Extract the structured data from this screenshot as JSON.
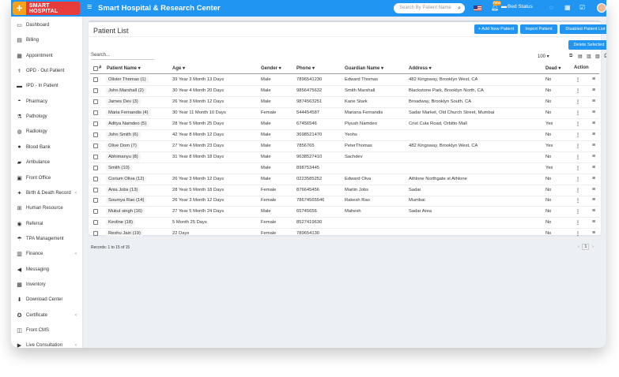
{
  "header": {
    "logo_text": "SMART HOSPITAL",
    "app_title": "Smart Hospital & Research Center",
    "search_placeholder": "Search By Patient Name",
    "bed_status": "Bed Status",
    "bell_badge": "new"
  },
  "sidebar": {
    "items": [
      {
        "label": "Dashboard",
        "icon": "monitor-icon",
        "chev": false
      },
      {
        "label": "Billing",
        "icon": "file-icon",
        "chev": false
      },
      {
        "label": "Appointment",
        "icon": "calendar-icon",
        "chev": false
      },
      {
        "label": "OPD - Out Patient",
        "icon": "stethoscope-icon",
        "chev": false
      },
      {
        "label": "IPD - In Patient",
        "icon": "procedures-icon",
        "chev": false
      },
      {
        "label": "Pharmacy",
        "icon": "mortar-icon",
        "chev": false
      },
      {
        "label": "Pathology",
        "icon": "flask-icon",
        "chev": false
      },
      {
        "label": "Radiology",
        "icon": "microscope-icon",
        "chev": false
      },
      {
        "label": "Blood Bank",
        "icon": "tint-icon",
        "chev": false
      },
      {
        "label": "Ambulance",
        "icon": "ambulance-icon",
        "chev": false
      },
      {
        "label": "Front Office",
        "icon": "dumpster-icon",
        "chev": false
      },
      {
        "label": "Birth & Death Record",
        "icon": "birthday-icon",
        "chev": true
      },
      {
        "label": "Human Resource",
        "icon": "sitemap-icon",
        "chev": false
      },
      {
        "label": "Referral",
        "icon": "users-icon",
        "chev": false
      },
      {
        "label": "TPA Management",
        "icon": "umbrella-icon",
        "chev": false
      },
      {
        "label": "Finance",
        "icon": "money-icon",
        "chev": true
      },
      {
        "label": "Messaging",
        "icon": "bullhorn-icon",
        "chev": false
      },
      {
        "label": "Inventory",
        "icon": "box-icon",
        "chev": false
      },
      {
        "label": "Download Center",
        "icon": "download-icon",
        "chev": false
      },
      {
        "label": "Certificate",
        "icon": "certificate-icon",
        "chev": true
      },
      {
        "label": "Front CMS",
        "icon": "cms-icon",
        "chev": false
      },
      {
        "label": "Live Consultation",
        "icon": "video-icon",
        "chev": true
      }
    ]
  },
  "panel": {
    "title": "Patient List",
    "add_btn": "+ Add New Patient",
    "import_btn": "Import Patient",
    "disabled_btn": "Disabled Patient List",
    "delete_btn": "Delete Selected",
    "search_label": "Search...",
    "page_size": "100",
    "records_text": "Records: 1 to 15 of 15",
    "current_page": "1"
  },
  "table": {
    "headers": {
      "index": "#",
      "name": "Patient Name",
      "age": "Age",
      "gender": "Gender",
      "phone": "Phone",
      "guardian": "Guardian Name",
      "address": "Address",
      "dead": "Dead",
      "action": "Action"
    },
    "rows": [
      {
        "name": "Olivier Thomas (1)",
        "age": "39 Year 3 Month 13 Days",
        "gender": "Male",
        "phone": "7896541230",
        "guardian": "Edward Thomas",
        "address": "482 Kingsway, Brooklyn West, CA",
        "dead": "No"
      },
      {
        "name": "John Marshall (2)",
        "age": "30 Year 4 Month 20 Days",
        "gender": "Male",
        "phone": "9856475632",
        "guardian": "Smith Marshall",
        "address": "Blackstone Park, Brooklyn North, CA",
        "dead": "No"
      },
      {
        "name": "James Dev (3)",
        "age": "26 Year 3 Month 12 Days",
        "gender": "Male",
        "phone": "9874563251",
        "guardian": "Kane Stark",
        "address": "Broadway, Brooklyn South, CA",
        "dead": "No"
      },
      {
        "name": "Maria Fernandis (4)",
        "age": "30 Year 11 Month 10 Days",
        "gender": "Female",
        "phone": "544454587",
        "guardian": "Mariana Fernandis",
        "address": "Sadar Market, Old Church Street, Mumbai",
        "dead": "No"
      },
      {
        "name": "Aditya Namdeo (5)",
        "age": "28 Year 5 Month 25 Days",
        "gender": "Male",
        "phone": "67456546",
        "guardian": "Piyush Namdeo",
        "address": "Crist Cula Road, Orbitto Mall",
        "dead": "Yes"
      },
      {
        "name": "John Smith (6)",
        "age": "42 Year 8 Month 12 Days",
        "gender": "Male",
        "phone": "3698521470",
        "guardian": "Yeohs",
        "address": "",
        "dead": "No"
      },
      {
        "name": "Olive Dom (7)",
        "age": "27 Year 4 Month 23 Days",
        "gender": "Male",
        "phone": "7856765",
        "guardian": "PeterThomas",
        "address": "482 Kingsway, Brooklyn West, CA",
        "dead": "Yes"
      },
      {
        "name": "Abhimanyu (8)",
        "age": "31 Year 8 Month 18 Days",
        "gender": "Male",
        "phone": "9638527410",
        "guardian": "Sachdev",
        "address": "",
        "dead": "No"
      },
      {
        "name": "Smith (10)",
        "age": "",
        "gender": "Male",
        "phone": "898753445",
        "guardian": "",
        "address": "",
        "dead": "Yes"
      },
      {
        "name": "Corium Oliva (12)",
        "age": "26 Year 3 Month 12 Days",
        "gender": "Male",
        "phone": "0223585252",
        "guardian": "Edward Olva",
        "address": "Athlone Northgate st Athlone",
        "dead": "No"
      },
      {
        "name": "Ania Jobs (13)",
        "age": "28 Year 5 Month 18 Days",
        "gender": "Female",
        "phone": "876645456",
        "guardian": "Martin Jobs",
        "address": "Sadar",
        "dead": "No"
      },
      {
        "name": "Soumya Rao (14)",
        "age": "26 Year 3 Month 12 Days",
        "gender": "Female",
        "phone": "78674565546",
        "guardian": "Rakesh Rao",
        "address": "Mumbai",
        "dead": "No"
      },
      {
        "name": "Mukul singh (16)",
        "age": "27 Year 5 Month 24 Days",
        "gender": "Male",
        "phone": "65745656",
        "guardian": "Mahesh",
        "address": "Sadar Area",
        "dead": "No"
      },
      {
        "name": "Kevline (18)",
        "age": "5 Month 25 Days",
        "gender": "Female",
        "phone": "8527419630",
        "guardian": "",
        "address": "",
        "dead": "No"
      },
      {
        "name": "Reshu Jain (19)",
        "age": "22 Days",
        "gender": "Female",
        "phone": "789654130",
        "guardian": "",
        "address": "",
        "dead": "No"
      }
    ]
  }
}
